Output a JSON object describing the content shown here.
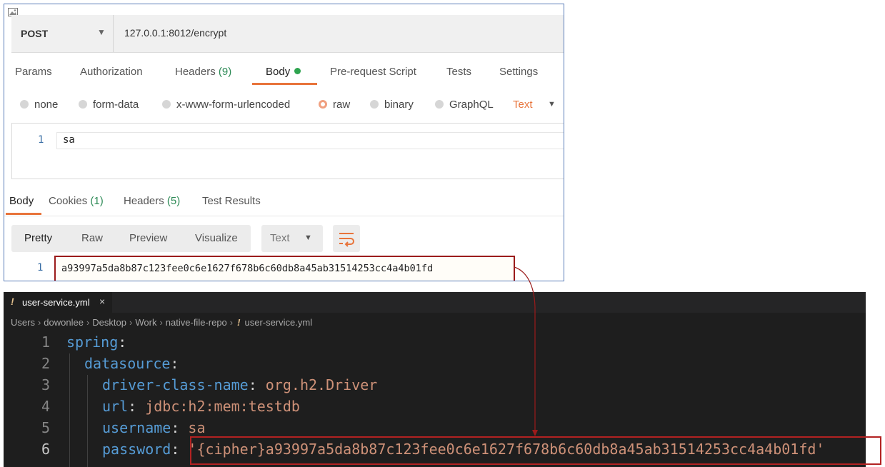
{
  "postman": {
    "method": "POST",
    "url": "127.0.0.1:8012/encrypt",
    "request_tabs": [
      {
        "label": "Params",
        "count": ""
      },
      {
        "label": "Authorization",
        "count": ""
      },
      {
        "label": "Headers",
        "count": "(9)"
      },
      {
        "label": "Body",
        "count": ""
      },
      {
        "label": "Pre-request Script",
        "count": ""
      },
      {
        "label": "Tests",
        "count": ""
      },
      {
        "label": "Settings",
        "count": ""
      }
    ],
    "active_request_tab": "Body",
    "body_types": [
      "none",
      "form-data",
      "x-www-form-urlencoded",
      "raw",
      "binary",
      "GraphQL"
    ],
    "selected_body_type": "raw",
    "raw_format": "Text",
    "request_body": {
      "line": "1",
      "text": "sa"
    },
    "response_tabs": [
      {
        "label": "Body",
        "count": ""
      },
      {
        "label": "Cookies",
        "count": "(1)"
      },
      {
        "label": "Headers",
        "count": "(5)"
      },
      {
        "label": "Test Results",
        "count": ""
      }
    ],
    "view_modes": [
      "Pretty",
      "Raw",
      "Preview",
      "Visualize"
    ],
    "active_view": "Pretty",
    "response_format": "Text",
    "response_body": {
      "line": "1",
      "text": "a93997a5da8b87c123fee0c6e1627f678b6c60db8a45ab31514253cc4a4b01fd"
    }
  },
  "editor": {
    "tab_name": "user-service.yml",
    "breadcrumb": [
      "Users",
      "dowonlee",
      "Desktop",
      "Work",
      "native-file-repo",
      "user-service.yml"
    ],
    "lines": [
      {
        "no": "1",
        "key": "spring",
        "value": ""
      },
      {
        "no": "2",
        "key": "datasource",
        "value": ""
      },
      {
        "no": "3",
        "key": "driver-class-name",
        "value": "org.h2.Driver"
      },
      {
        "no": "4",
        "key": "url",
        "value": "jdbc:h2:mem:testdb"
      },
      {
        "no": "5",
        "key": "username",
        "value": "sa"
      },
      {
        "no": "6",
        "key": "password",
        "value": "'{cipher}a93997a5da8b87c123fee0c6e1627f678b6c60db8a45ab31514253cc4a4b01fd'"
      }
    ]
  },
  "colors": {
    "accent": "#e8743b",
    "highlight_border": "#9b1b1b",
    "count_green": "#2e8b57",
    "yaml_key": "#569cd6",
    "yaml_value": "#ce9178"
  }
}
